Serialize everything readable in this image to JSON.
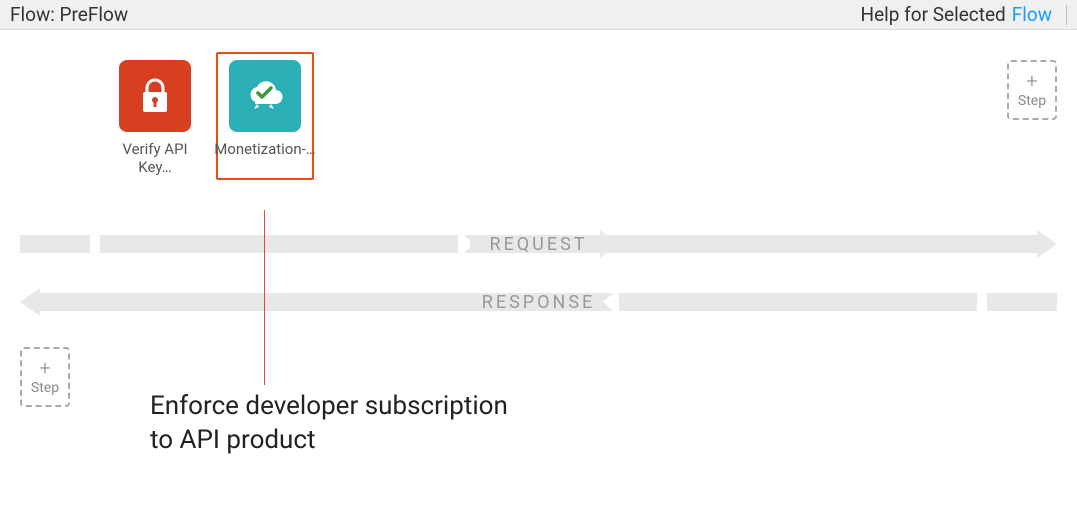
{
  "header": {
    "flow_label": "Flow: PreFlow",
    "help_label": "Help for Selected",
    "flow_link": "Flow"
  },
  "policies": [
    {
      "label": "Verify API Key…",
      "icon": "lock",
      "color": "red",
      "selected": false
    },
    {
      "label": "Monetization-…",
      "icon": "cloud-check",
      "color": "teal",
      "selected": true
    }
  ],
  "flow": {
    "request_label": "REQUEST",
    "response_label": "RESPONSE"
  },
  "add_step": {
    "plus": "+",
    "label": "Step"
  },
  "annotation": "Enforce developer subscription\nto API product"
}
